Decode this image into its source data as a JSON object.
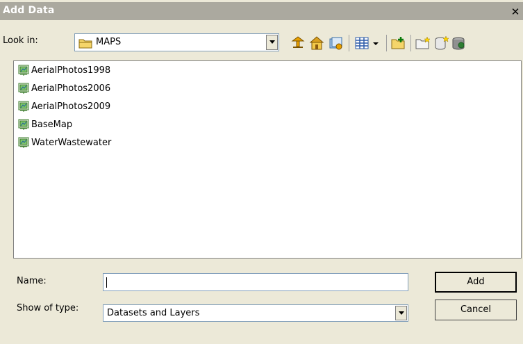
{
  "window": {
    "title": "Add Data",
    "close_glyph": "✕"
  },
  "look_in": {
    "label": "Look in:",
    "value": "MAPS",
    "icon": "folder-icon"
  },
  "toolbar": {
    "buttons": [
      "up-one-level-icon",
      "home-icon",
      "catalog-connect-icon",
      "view-menu-icon",
      "connect-folder-icon",
      "new-folder-icon",
      "new-geodatabase-icon",
      "database-icon"
    ]
  },
  "files": [
    {
      "name": "AerialPhotos1998",
      "icon": "map-document-icon"
    },
    {
      "name": "AerialPhotos2006",
      "icon": "map-document-icon"
    },
    {
      "name": "AerialPhotos2009",
      "icon": "map-document-icon"
    },
    {
      "name": "BaseMap",
      "icon": "map-document-icon"
    },
    {
      "name": "WaterWastewater",
      "icon": "map-document-icon"
    }
  ],
  "name_field": {
    "label": "Name:",
    "value": ""
  },
  "type_field": {
    "label": "Show of type:",
    "value": "Datasets and Layers"
  },
  "buttons": {
    "add": "Add",
    "cancel": "Cancel"
  }
}
